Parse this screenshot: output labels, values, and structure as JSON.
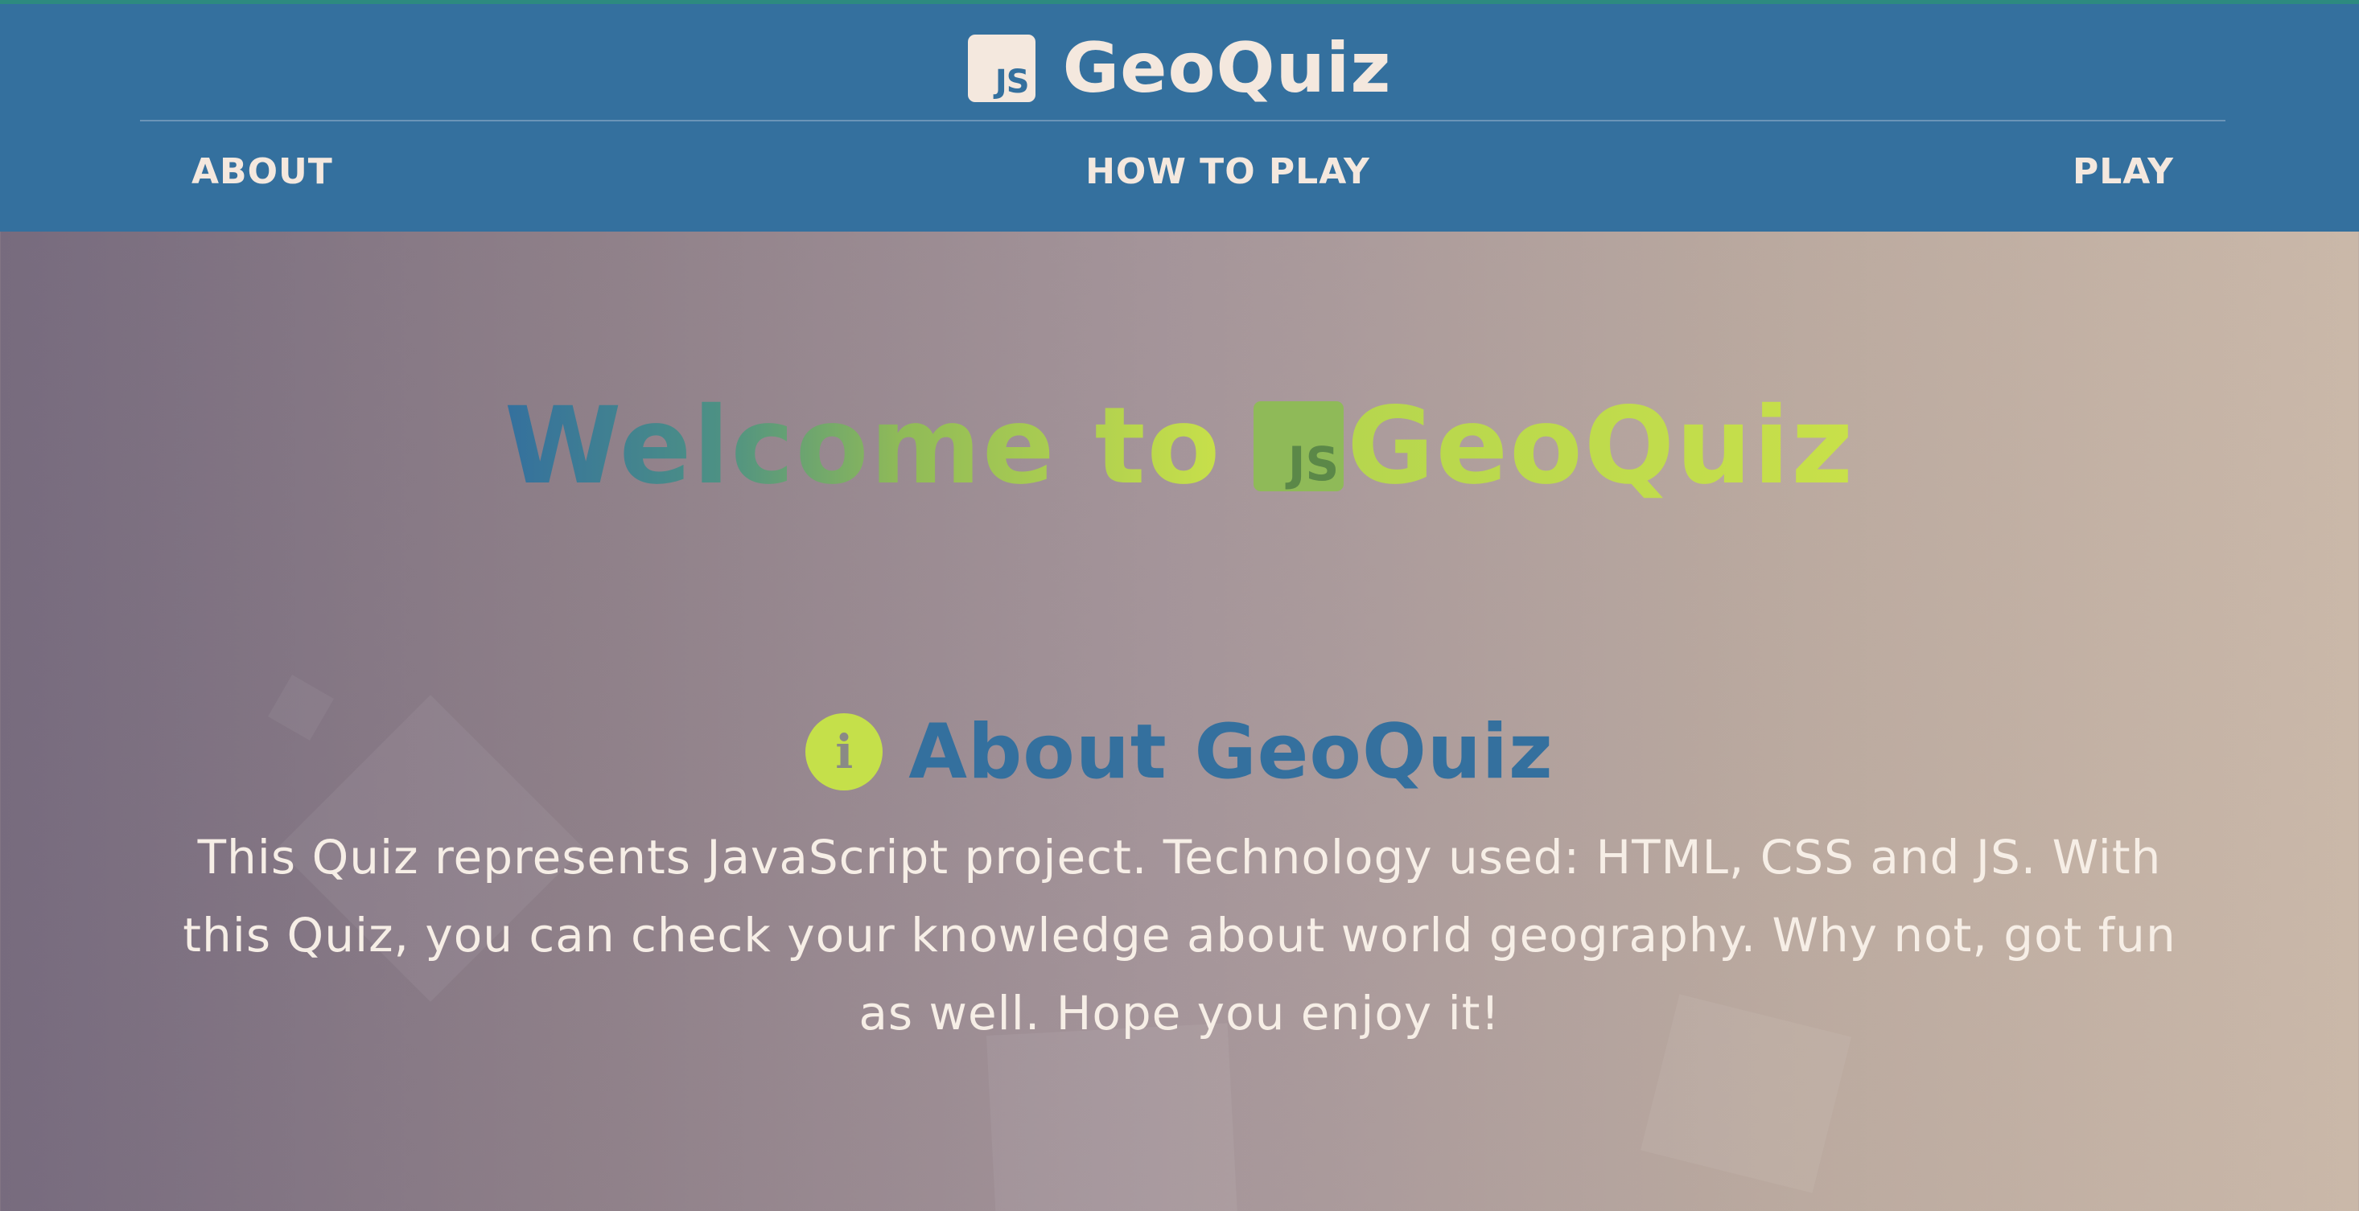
{
  "header": {
    "logo_badge": "JS",
    "brand": "GeoQuiz"
  },
  "nav": {
    "about": "ABOUT",
    "how_to_play": "HOW TO PLAY",
    "play": "PLAY"
  },
  "hero": {
    "welcome_lead": "Welcome to",
    "badge": "JS",
    "brand": "GeoQuiz"
  },
  "about": {
    "icon": "info-icon",
    "icon_glyph": "i",
    "heading": "About GeoQuiz",
    "text": "This Quiz represents JavaScript project. Technology used: HTML, CSS and JS. With this Quiz, you can check your knowledge about world geography. Why not, got fun as well. Hope you enjoy it!"
  },
  "colors": {
    "header_bg": "#34709e",
    "accent_green": "#c5e04a",
    "text_light": "#f4e8de"
  }
}
